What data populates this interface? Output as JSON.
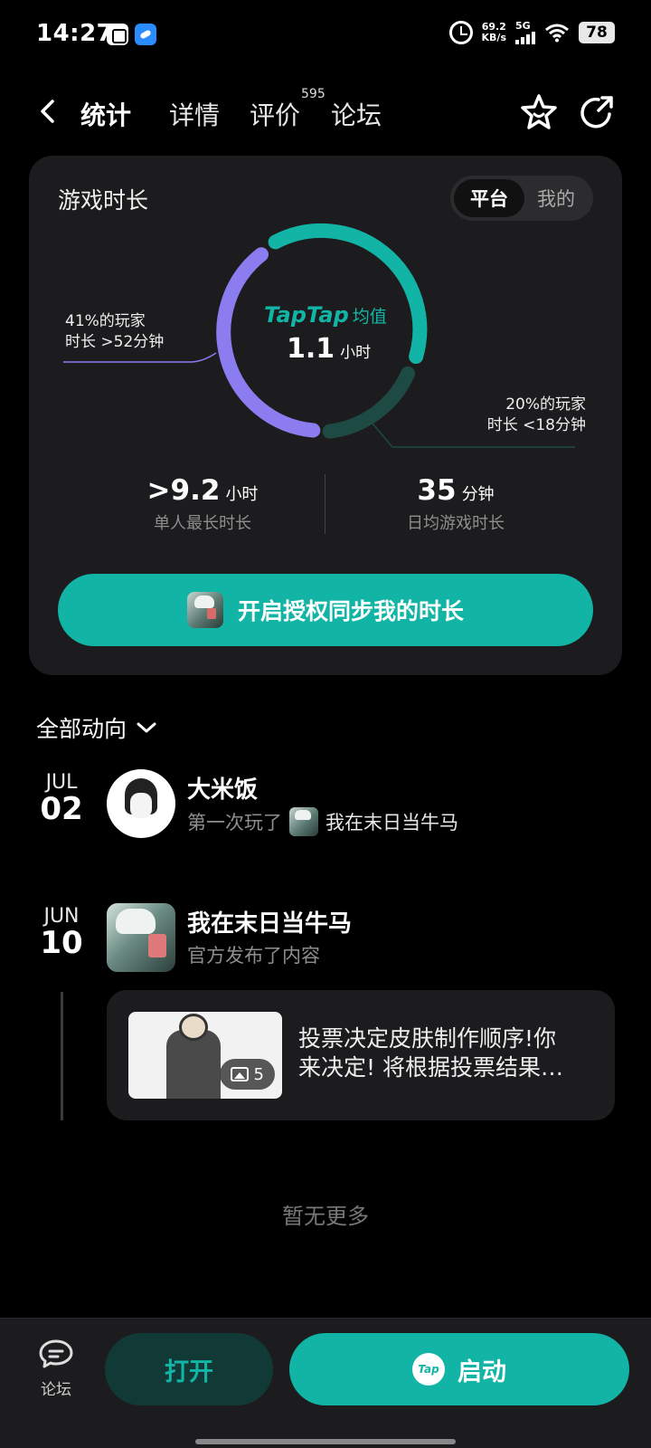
{
  "status_bar": {
    "time": "14:27",
    "net_speed_value": "69.2",
    "net_speed_unit": "KB/s",
    "network": "5G",
    "battery": "78"
  },
  "nav": {
    "tabs": [
      {
        "label": "统计",
        "active": true
      },
      {
        "label": "详情",
        "active": false
      },
      {
        "label": "评价",
        "active": false,
        "badge": "595"
      },
      {
        "label": "论坛",
        "active": false
      }
    ]
  },
  "stats": {
    "title": "游戏时长",
    "toggle": {
      "platform": "平台",
      "mine": "我的",
      "selected": "平台"
    },
    "brand": "TapTap",
    "brand_suffix": "均值",
    "avg_value": "1.1",
    "avg_unit": "小时",
    "callout_left_line1": "41%的玩家",
    "callout_left_line2": "时长 >52分钟",
    "callout_right_line1": "20%的玩家",
    "callout_right_line2": "时长 <18分钟",
    "max_value": ">9.2",
    "max_unit": "小时",
    "max_label": "单人最长时长",
    "daily_value": "35",
    "daily_unit": "分钟",
    "daily_label": "日均游戏时长",
    "sync_button": "开启授权同步我的时长",
    "colors": {
      "accent": "#12b5a5",
      "purple": "#8b7cf0",
      "dark_teal": "#1e4a44"
    }
  },
  "feed": {
    "filter_label": "全部动向",
    "items": [
      {
        "month": "JUL",
        "day": "02",
        "name": "大米饭",
        "action": "第一次玩了",
        "game": "我在末日当牛马"
      },
      {
        "month": "JUN",
        "day": "10",
        "name": "我在末日当牛马",
        "action": "官方发布了内容"
      }
    ],
    "post": {
      "line1": "投票决定皮肤制作顺序!你",
      "line2": "来决定! 将根据投票结果…",
      "image_count": "5"
    },
    "no_more": "暂无更多"
  },
  "bottom_bar": {
    "forum_label": "论坛",
    "open_label": "打开",
    "launch_label": "启动",
    "tap_icon_text": "Tap"
  }
}
